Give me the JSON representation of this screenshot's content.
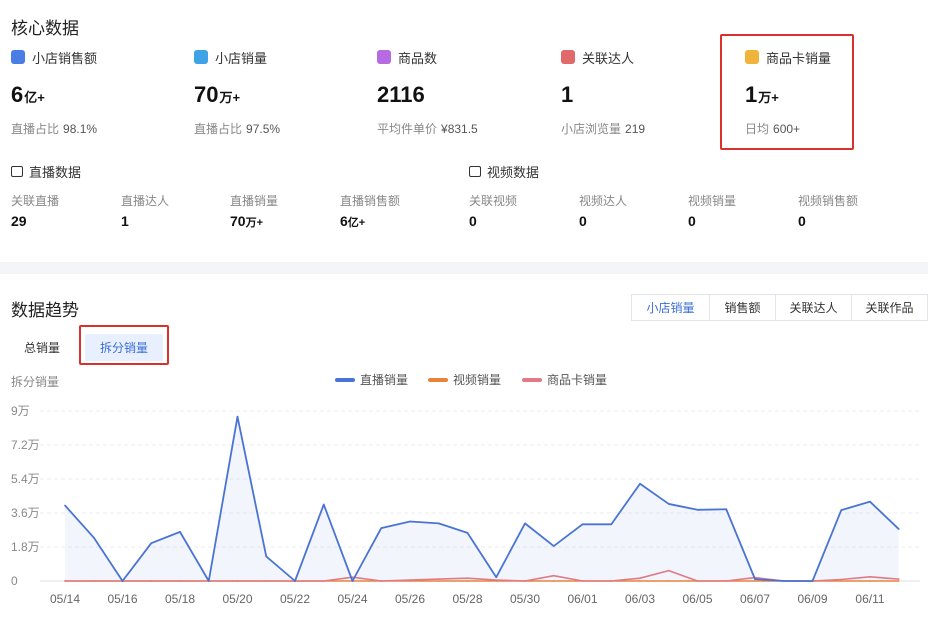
{
  "core": {
    "title": "核心数据",
    "metrics": [
      {
        "label": "小店销售额",
        "value": "6",
        "unit": "亿+",
        "sub_label": "直播占比",
        "sub_value": "98.1%",
        "icon": "wallet-icon",
        "color": "#4a7de6"
      },
      {
        "label": "小店销量",
        "value": "70",
        "unit": "万+",
        "sub_label": "直播占比",
        "sub_value": "97.5%",
        "icon": "shopping-bag-icon",
        "color": "#3fa2e6"
      },
      {
        "label": "商品数",
        "value": "2116",
        "unit": "",
        "sub_label": "平均件单价",
        "sub_value": "¥831.5",
        "icon": "basket-icon",
        "color": "#b86ae0"
      },
      {
        "label": "关联达人",
        "value": "1",
        "unit": "",
        "sub_label": "小店浏览量",
        "sub_value": "219",
        "icon": "user-icon",
        "color": "#e06a6a"
      },
      {
        "label": "商品卡销量",
        "value": "1",
        "unit": "万+",
        "sub_label": "日均",
        "sub_value": "600+",
        "icon": "card-icon",
        "color": "#f0b43a"
      }
    ]
  },
  "live": {
    "title": "直播数据",
    "stats": [
      {
        "label": "关联直播",
        "value": "29",
        "unit": ""
      },
      {
        "label": "直播达人",
        "value": "1",
        "unit": ""
      },
      {
        "label": "直播销量",
        "value": "70",
        "unit": "万+"
      },
      {
        "label": "直播销售额",
        "value": "6",
        "unit": "亿+"
      }
    ]
  },
  "video": {
    "title": "视频数据",
    "stats": [
      {
        "label": "关联视频",
        "value": "0",
        "unit": ""
      },
      {
        "label": "视频达人",
        "value": "0",
        "unit": ""
      },
      {
        "label": "视频销量",
        "value": "0",
        "unit": ""
      },
      {
        "label": "视频销售额",
        "value": "0",
        "unit": ""
      }
    ]
  },
  "trend": {
    "title": "数据趋势",
    "right_tabs": [
      "小店销量",
      "销售额",
      "关联达人",
      "关联作品"
    ],
    "active_right_tab": "小店销量",
    "left_tabs": [
      "总销量",
      "拆分销量"
    ],
    "active_left_tab": "拆分销量",
    "y_axis_title": "拆分销量"
  },
  "chart_data": {
    "type": "line",
    "x": [
      "05/14",
      "05/15",
      "05/16",
      "05/17",
      "05/18",
      "05/19",
      "05/20",
      "05/21",
      "05/22",
      "05/23",
      "05/24",
      "05/25",
      "05/26",
      "05/27",
      "05/28",
      "05/29",
      "05/30",
      "05/31",
      "06/01",
      "06/02",
      "06/03",
      "06/04",
      "06/05",
      "06/06",
      "06/07",
      "06/08",
      "06/09",
      "06/10",
      "06/11",
      "06/12"
    ],
    "x_tick_labels": [
      "05/14",
      "05/16",
      "05/18",
      "05/20",
      "05/22",
      "05/24",
      "05/26",
      "05/28",
      "05/30",
      "06/01",
      "06/03",
      "06/05",
      "06/07",
      "06/09",
      "06/11"
    ],
    "y_tick_labels": [
      "0",
      "1.8万",
      "3.6万",
      "5.4万",
      "7.2万",
      "9万"
    ],
    "ylim": [
      0,
      90000
    ],
    "grid": true,
    "legend_position": "top-center",
    "series": [
      {
        "name": "直播销量",
        "color": "#4a74d4",
        "area": true,
        "values": [
          40000,
          23000,
          0,
          20000,
          26000,
          0,
          87000,
          13000,
          0,
          40500,
          0,
          28000,
          31500,
          30500,
          25500,
          2000,
          30500,
          18500,
          30000,
          30000,
          51500,
          40800,
          37700,
          38000,
          1000,
          0,
          0,
          37500,
          42000,
          27500
        ]
      },
      {
        "name": "视频销量",
        "color": "#e8833a",
        "area": false,
        "values": [
          0,
          0,
          0,
          0,
          0,
          0,
          0,
          0,
          0,
          0,
          0,
          0,
          0,
          0,
          0,
          0,
          0,
          0,
          0,
          0,
          0,
          0,
          0,
          0,
          0,
          0,
          0,
          0,
          0,
          0
        ]
      },
      {
        "name": "商品卡销量",
        "color": "#e07a86",
        "area": false,
        "values": [
          0,
          0,
          0,
          0,
          0,
          0,
          0,
          0,
          0,
          0,
          2000,
          0,
          500,
          1000,
          1500,
          500,
          0,
          2800,
          0,
          0,
          1500,
          5500,
          0,
          0,
          1800,
          0,
          0,
          800,
          2200,
          1000
        ]
      }
    ]
  }
}
